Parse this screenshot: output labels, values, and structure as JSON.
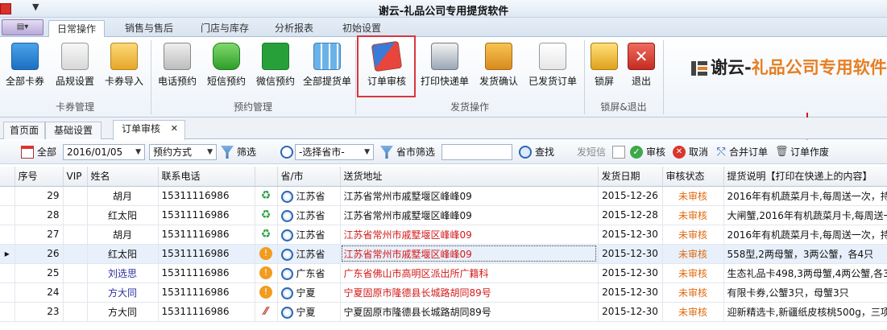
{
  "window": {
    "title": "谢云-礼品公司专用提货软件"
  },
  "ribbon_tabs": [
    "日常操作",
    "销售与售后",
    "门店与库存",
    "分析报表",
    "初始设置"
  ],
  "ribbon_groups": {
    "card": {
      "label": "卡券管理",
      "buttons": [
        "全部卡券",
        "品规设置",
        "卡券导入"
      ]
    },
    "booking": {
      "label": "预约管理",
      "buttons": [
        "电话预约",
        "短信预约",
        "微信预约",
        "全部提货单"
      ]
    },
    "shipping": {
      "label": "发货操作",
      "buttons": [
        "订单审核",
        "打印快递单",
        "发货确认",
        "已发货订单"
      ]
    },
    "lock": {
      "label": "锁屏&退出",
      "buttons": [
        "锁屏",
        "退出"
      ]
    }
  },
  "brand": {
    "name": "谢云-",
    "subtitle": "礼品公司专用软件",
    "accent": "#e67e22"
  },
  "doc_tabs": [
    "首页面",
    "基础设置",
    "订单审核"
  ],
  "toolbar": {
    "all_label": "全部",
    "date": "2016/01/05",
    "booking_method": "预约方式",
    "filter": "筛选",
    "province_select": "-选择省市-",
    "province_filter": "省市筛选",
    "search_value": "",
    "search": "查找",
    "sms": "发短信",
    "audit": "审核",
    "cancel": "取消",
    "merge": "合并订单",
    "void": "订单作废"
  },
  "table": {
    "columns": [
      "序号",
      "VIP",
      "姓名",
      "联系电话",
      "",
      "省/市",
      "送货地址",
      "发货日期",
      "审核状态",
      "提货说明【打印在快递上的内容】"
    ],
    "rows": [
      {
        "no": "29",
        "name": "胡月",
        "phone": "15311116986",
        "icon": "recycle",
        "prov": "江苏省",
        "addr": "江苏省常州市戚墅堰区峰峰09",
        "addr_red": false,
        "date": "2015-12-26",
        "status": "未审核",
        "note": "2016年有机蔬菜月卡,每周送一次，持",
        "name_navy": false
      },
      {
        "no": "28",
        "name": "红太阳",
        "phone": "15311116986",
        "icon": "recycle",
        "prov": "江苏省",
        "addr": "江苏省常州市戚墅堰区峰峰09",
        "addr_red": false,
        "date": "2015-12-28",
        "status": "未审核",
        "note": "大闸蟹,2016年有机蔬菜月卡,每周送一",
        "name_navy": false
      },
      {
        "no": "27",
        "name": "胡月",
        "phone": "15311116986",
        "icon": "recycle",
        "prov": "江苏省",
        "addr": "江苏省常州市戚墅堰区峰峰09",
        "addr_red": true,
        "date": "2015-12-30",
        "status": "未审核",
        "note": "2016年有机蔬菜月卡,每周送一次，持",
        "name_navy": false
      },
      {
        "no": "26",
        "name": "红太阳",
        "phone": "15311116986",
        "icon": "alert",
        "prov": "江苏省",
        "addr": "江苏省常州市戚墅堰区峰峰09",
        "addr_red": true,
        "date": "2015-12-30",
        "status": "未审核",
        "note": "558型,2两母蟹，3两公蟹，各4只",
        "name_navy": false,
        "selected": true
      },
      {
        "no": "25",
        "name": "刘选思",
        "phone": "15311116986",
        "icon": "alert",
        "prov": "广东省",
        "addr": "广东省佛山市高明区派出所广籍科",
        "addr_red": true,
        "date": "2015-12-30",
        "status": "未审核",
        "note": "生态礼品卡498,3两母蟹,4两公蟹,各3",
        "name_navy": true
      },
      {
        "no": "24",
        "name": "方大同",
        "phone": "15311116986",
        "icon": "alert",
        "prov": "宁夏",
        "addr": "宁夏固原市隆德县长城路胡同89号",
        "addr_red": true,
        "date": "2015-12-30",
        "status": "未审核",
        "note": "有限卡券,公蟹3只，母蟹3只",
        "name_navy": true
      },
      {
        "no": "23",
        "name": "方大同",
        "phone": "15311116986",
        "icon": "slash",
        "prov": "宁夏",
        "addr": "宁夏固原市隆德县长城路胡同89号",
        "addr_red": false,
        "date": "2015-12-30",
        "status": "未审核",
        "note": "迎新精选卡,新疆纸皮核桃500g，三项",
        "name_navy": false
      }
    ]
  }
}
